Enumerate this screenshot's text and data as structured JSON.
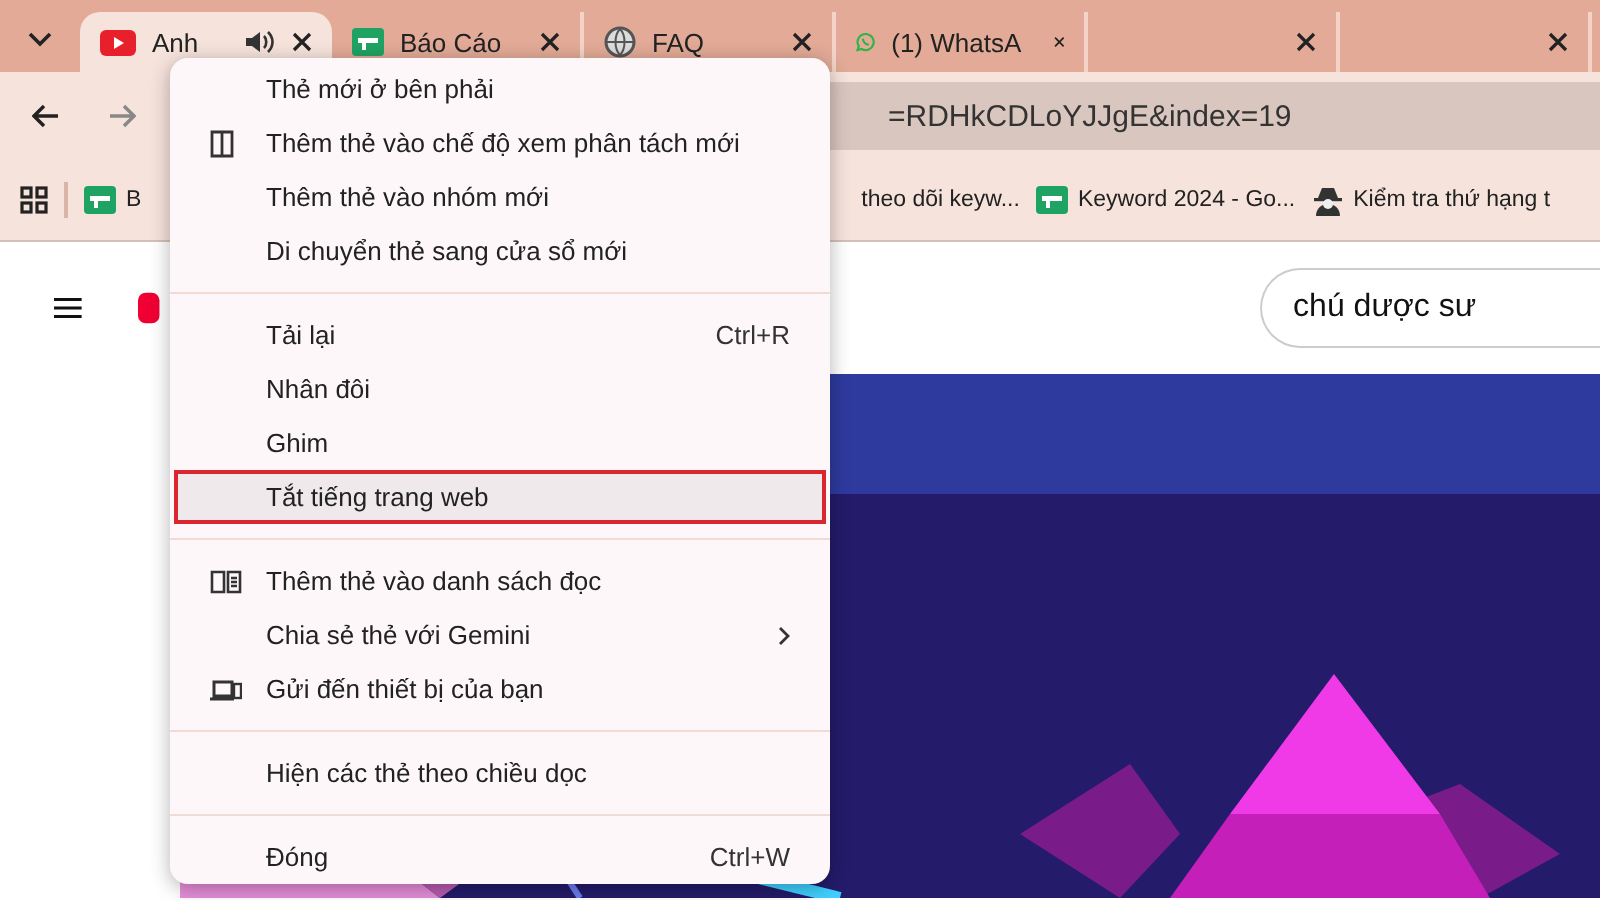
{
  "tabs": [
    {
      "label": "Anh",
      "kind": "youtube",
      "audio": true,
      "selected": true
    },
    {
      "label": "Báo Cáo",
      "kind": "sheet",
      "audio": false,
      "selected": false
    },
    {
      "label": "FAQ",
      "kind": "globe",
      "audio": false,
      "selected": false
    },
    {
      "label": "(1) WhatsA",
      "kind": "whatsapp",
      "audio": false,
      "selected": false
    },
    {
      "kind": "blank",
      "audio": false,
      "selected": false
    },
    {
      "kind": "blank",
      "audio": false,
      "selected": false
    }
  ],
  "toolbar": {
    "url": "=RDHkCDLoYJJgE&index=19"
  },
  "bookmarks": [
    {
      "label": "B",
      "kind": "sheet"
    },
    {
      "label": "theo dõi keyw...",
      "kind": "plain"
    },
    {
      "label": "Keyword 2024 - Go...",
      "kind": "sheet"
    },
    {
      "label": "Kiểm tra thứ hạng t",
      "kind": "spy"
    }
  ],
  "page": {
    "search": {
      "value": "chú dược sư"
    }
  },
  "context_menu": {
    "groups": [
      [
        {
          "label": "Thẻ mới ở bên phải",
          "selected": false
        },
        {
          "label": "Thêm thẻ vào chế độ xem phân tách mới",
          "kind": "split",
          "selected": false
        },
        {
          "label": "Thêm thẻ vào nhóm mới",
          "selected": false
        },
        {
          "label": "Di chuyển thẻ sang cửa sổ mới",
          "selected": false
        }
      ],
      [
        {
          "label": "Tải lại",
          "shortcut": "Ctrl+R",
          "selected": false
        },
        {
          "label": "Nhân đôi",
          "selected": false
        },
        {
          "label": "Ghim",
          "selected": false
        },
        {
          "label": "Tắt tiếng trang web",
          "selected": true
        }
      ],
      [
        {
          "label": "Thêm thẻ vào danh sách đọc",
          "kind": "reading",
          "selected": false
        },
        {
          "label": "Chia sẻ thẻ với Gemini",
          "submenu": true,
          "selected": false
        },
        {
          "label": "Gửi đến thiết bị của bạn",
          "kind": "device",
          "selected": false
        }
      ],
      [
        {
          "label": "Hiện các thẻ theo chiều dọc",
          "selected": false
        }
      ],
      [
        {
          "label": "Đóng",
          "shortcut": "Ctrl+W",
          "selected": false
        }
      ]
    ]
  }
}
